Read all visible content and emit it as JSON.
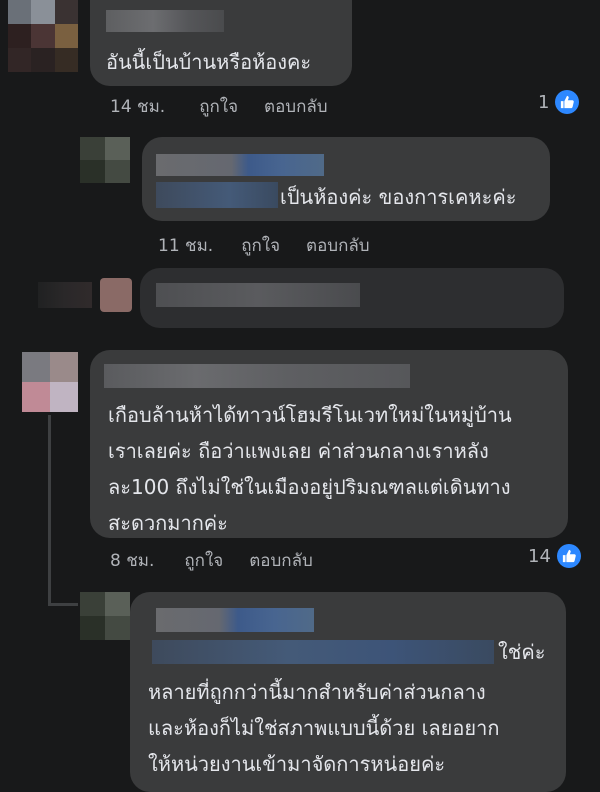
{
  "comments": [
    {
      "text_lines": [
        "อันนี้เป็นบ้านหรือห้องคะ"
      ],
      "time": "14 ชม.",
      "like_label": "ถูกใจ",
      "reply_label": "ตอบกลับ",
      "reactions": "1",
      "reaction_icon": "like-icon"
    },
    {
      "text_lines": [
        "เป็นห้องค่ะ ของการเคหะค่ะ"
      ],
      "time": "11 ชม.",
      "like_label": "ถูกใจ",
      "reply_label": "ตอบกลับ"
    },
    {
      "text_lines": [
        "เกือบล้านห้าได้ทาวน์โฮมรีโนเวทใหม่ในหมู่บ้าน",
        "เราเลยค่ะ ถือว่าแพงเลย ค่าส่วนกลางเราหลัง",
        "ละ100 ถึงไม่ใช่ในเมืองอยู่ปริมณฑลแต่เดินทาง",
        "สะดวกมากค่ะ"
      ],
      "time": "8 ชม.",
      "like_label": "ถูกใจ",
      "reply_label": "ตอบกลับ",
      "reactions": "14",
      "reaction_icon": "like-icon"
    },
    {
      "text_lines": [
        "ใช่ค่ะ",
        "หลายที่ถูกกว่านี้มากสำหรับค่าส่วนกลาง",
        "และห้องก็ไม่ใช่สภาพแบบนี้ด้วย เลยอยาก",
        "ให้หน่วยงานเข้ามาจัดการหน่อยค่ะ"
      ]
    }
  ],
  "colors": {
    "background": "#18191a",
    "bubble": "#3a3b3c",
    "text": "#e4e6eb",
    "meta": "#b0b3b8",
    "like_blue": "#2d88ff"
  }
}
